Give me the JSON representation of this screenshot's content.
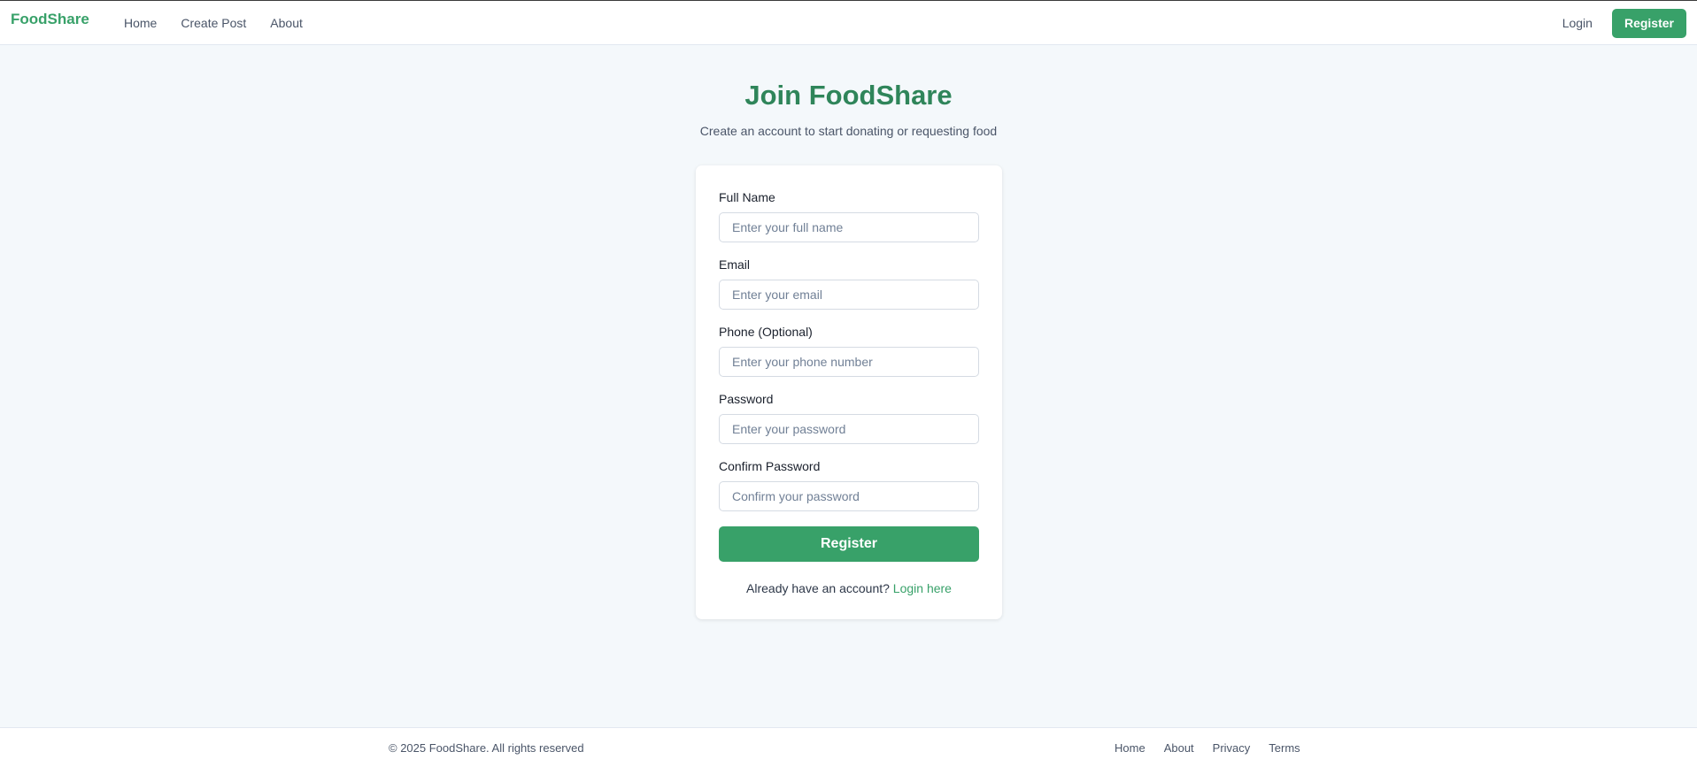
{
  "nav": {
    "brand": "FoodShare",
    "links": [
      "Home",
      "Create Post",
      "About"
    ],
    "login_label": "Login",
    "register_label": "Register"
  },
  "hero": {
    "title": "Join FoodShare",
    "subtitle": "Create an account to start donating or requesting food"
  },
  "form": {
    "fields": [
      {
        "label": "Full Name",
        "placeholder": "Enter your full name",
        "value": ""
      },
      {
        "label": "Email",
        "placeholder": "Enter your email",
        "value": ""
      },
      {
        "label": "Phone (Optional)",
        "placeholder": "Enter your phone number",
        "value": ""
      },
      {
        "label": "Password",
        "placeholder": "Enter your password",
        "value": ""
      },
      {
        "label": "Confirm Password",
        "placeholder": "Confirm your password",
        "value": ""
      }
    ],
    "submit_label": "Register",
    "switch_text": "Already have an account?",
    "switch_link": "Login here"
  },
  "footer": {
    "copyright": "© 2025 FoodShare. All rights reserved",
    "links": [
      "Home",
      "About",
      "Privacy",
      "Terms"
    ]
  },
  "colors": {
    "brand": "#38a169",
    "title": "#2f855a",
    "background": "#f4f8fb"
  }
}
